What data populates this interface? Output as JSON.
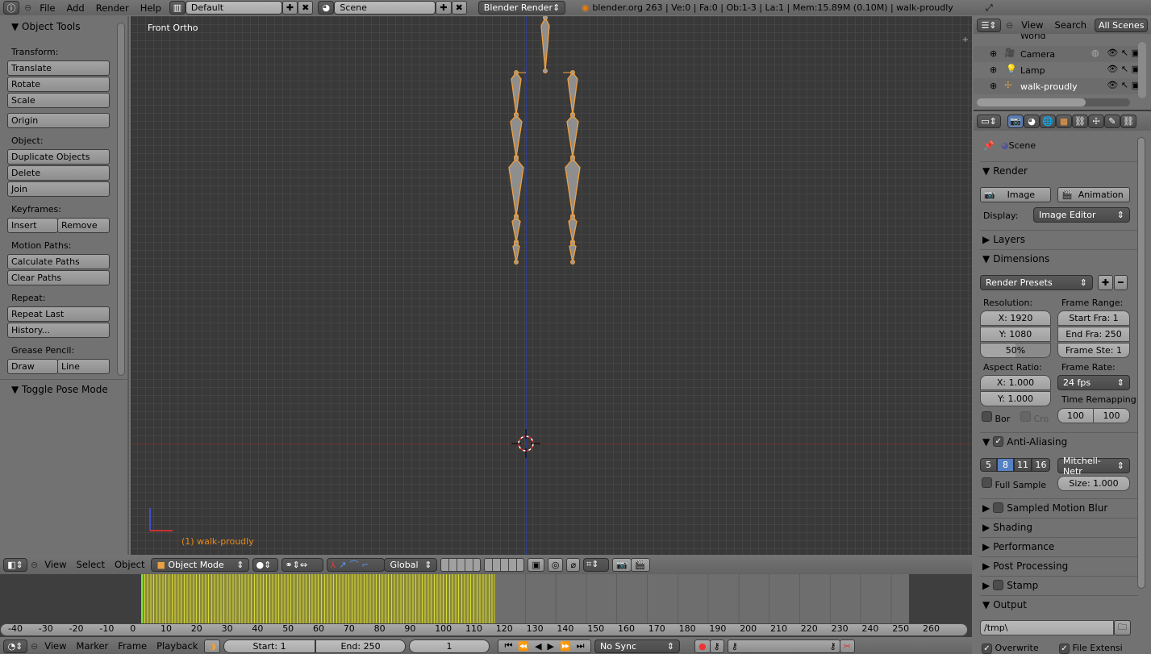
{
  "topbar": {
    "menus": [
      "File",
      "Add",
      "Render",
      "Help"
    ],
    "layout": "Default",
    "scene": "Scene",
    "engine": "Blender Render",
    "stats": "blender.org 263 | Ve:0 | Fa:0 | Ob:1-3 | La:1 | Mem:15.89M (0.10M) | walk-proudly"
  },
  "tools": {
    "title": "Object Tools",
    "sections": [
      {
        "label": "Transform:",
        "buttons": [
          "Translate",
          "Rotate",
          "Scale"
        ]
      },
      {
        "label": "",
        "buttons": [
          "Origin"
        ]
      },
      {
        "label": "Object:",
        "buttons": [
          "Duplicate Objects",
          "Delete",
          "Join"
        ]
      },
      {
        "label": "Keyframes:",
        "pair": [
          "Insert",
          "Remove"
        ]
      },
      {
        "label": "Motion Paths:",
        "buttons": [
          "Calculate Paths",
          "Clear Paths"
        ]
      },
      {
        "label": "Repeat:",
        "buttons": [
          "Repeat Last",
          "History..."
        ]
      },
      {
        "label": "Grease Pencil:",
        "pair": [
          "Draw",
          "Line"
        ]
      }
    ],
    "operator_panel": "Toggle Pose Mode"
  },
  "viewport": {
    "view_name": "Front Ortho",
    "object_label": "(1) walk-proudly"
  },
  "view3d_header": {
    "menus": [
      "View",
      "Select",
      "Object"
    ],
    "mode": "Object Mode",
    "orientation": "Global"
  },
  "timeline": {
    "ticks": [
      "-40",
      "-30",
      "-20",
      "-10",
      "0",
      "10",
      "20",
      "30",
      "40",
      "50",
      "60",
      "70",
      "80",
      "90",
      "100",
      "110",
      "120",
      "130",
      "140",
      "150",
      "160",
      "170",
      "180",
      "190",
      "200",
      "210",
      "220",
      "230",
      "240",
      "250",
      "260"
    ]
  },
  "timeline_header": {
    "menus": [
      "View",
      "Marker",
      "Frame",
      "Playback"
    ],
    "start": "Start: 1",
    "end": "End: 250",
    "current": "1",
    "sync": "No Sync"
  },
  "outliner": {
    "menus": [
      "View",
      "Search"
    ],
    "filter": "All Scenes",
    "items": [
      "World",
      "Camera",
      "Lamp",
      "walk-proudly"
    ]
  },
  "properties": {
    "context": "Scene",
    "render": {
      "title": "Render",
      "image": "Image",
      "animation": "Animation",
      "display_label": "Display:",
      "display": "Image Editor"
    },
    "layers": "Layers",
    "dimensions": {
      "title": "Dimensions",
      "presets": "Render Presets",
      "resolution_label": "Resolution:",
      "res_x": "X: 1920",
      "res_y": "Y: 1080",
      "res_pct": "50%",
      "res_pct_value": 50,
      "frame_range_label": "Frame Range:",
      "start": "Start Fra: 1",
      "end": "End Fra: 250",
      "step": "Frame Ste: 1",
      "aspect_label": "Aspect Ratio:",
      "asp_x": "X: 1.000",
      "asp_y": "Y: 1.000",
      "frame_rate_label": "Frame Rate:",
      "fps": "24 fps",
      "remap_label": "Time Remapping",
      "remap_old": "100",
      "remap_new": "100",
      "border": "Bor",
      "crop": "Cro"
    },
    "aa": {
      "title": "Anti-Aliasing",
      "samples": [
        "5",
        "8",
        "11",
        "16"
      ],
      "selected": "8",
      "filter": "Mitchell-Netr",
      "full_sample": "Full Sample",
      "size": "Size: 1.000"
    },
    "collapsed": [
      "Sampled Motion Blur",
      "Shading",
      "Performance",
      "Post Processing",
      "Stamp"
    ],
    "output": {
      "title": "Output",
      "path": "/tmp\\",
      "overwrite": "Overwrite",
      "file_ext": "File Extensi"
    }
  }
}
